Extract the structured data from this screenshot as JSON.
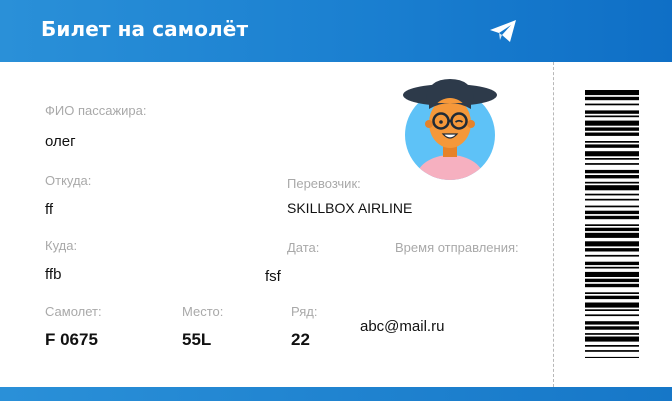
{
  "header": {
    "title": "Билет на самолёт"
  },
  "passenger": {
    "label": "ФИО пассажира:",
    "value": "олег"
  },
  "from": {
    "label": "Откуда:",
    "value": "ff"
  },
  "to": {
    "label": "Куда:",
    "value": "ffb"
  },
  "carrier": {
    "label": "Перевозчик:",
    "value": "SKILLBOX AIRLINE"
  },
  "date": {
    "label": "Дата:",
    "value": "fsf"
  },
  "departure_time": {
    "label": "Время отправления:",
    "value": ""
  },
  "plane": {
    "label": "Самолет:",
    "value": "F 0675"
  },
  "seat": {
    "label": "Место:",
    "value": "55L"
  },
  "row": {
    "label": "Ряд:",
    "value": "22"
  },
  "email": {
    "value": "abc@mail.ru"
  },
  "icons": {
    "header_icon": "paper-plane-icon",
    "avatar": "avatar-icon",
    "barcode": "barcode-icon"
  },
  "colors": {
    "header": "#1a7fd0",
    "label": "#a9a9a9",
    "avatar_bg": "#5ec2f7",
    "skin": "#f5983a",
    "hat": "#2d3a4a",
    "shirt": "#f6b0c0"
  }
}
